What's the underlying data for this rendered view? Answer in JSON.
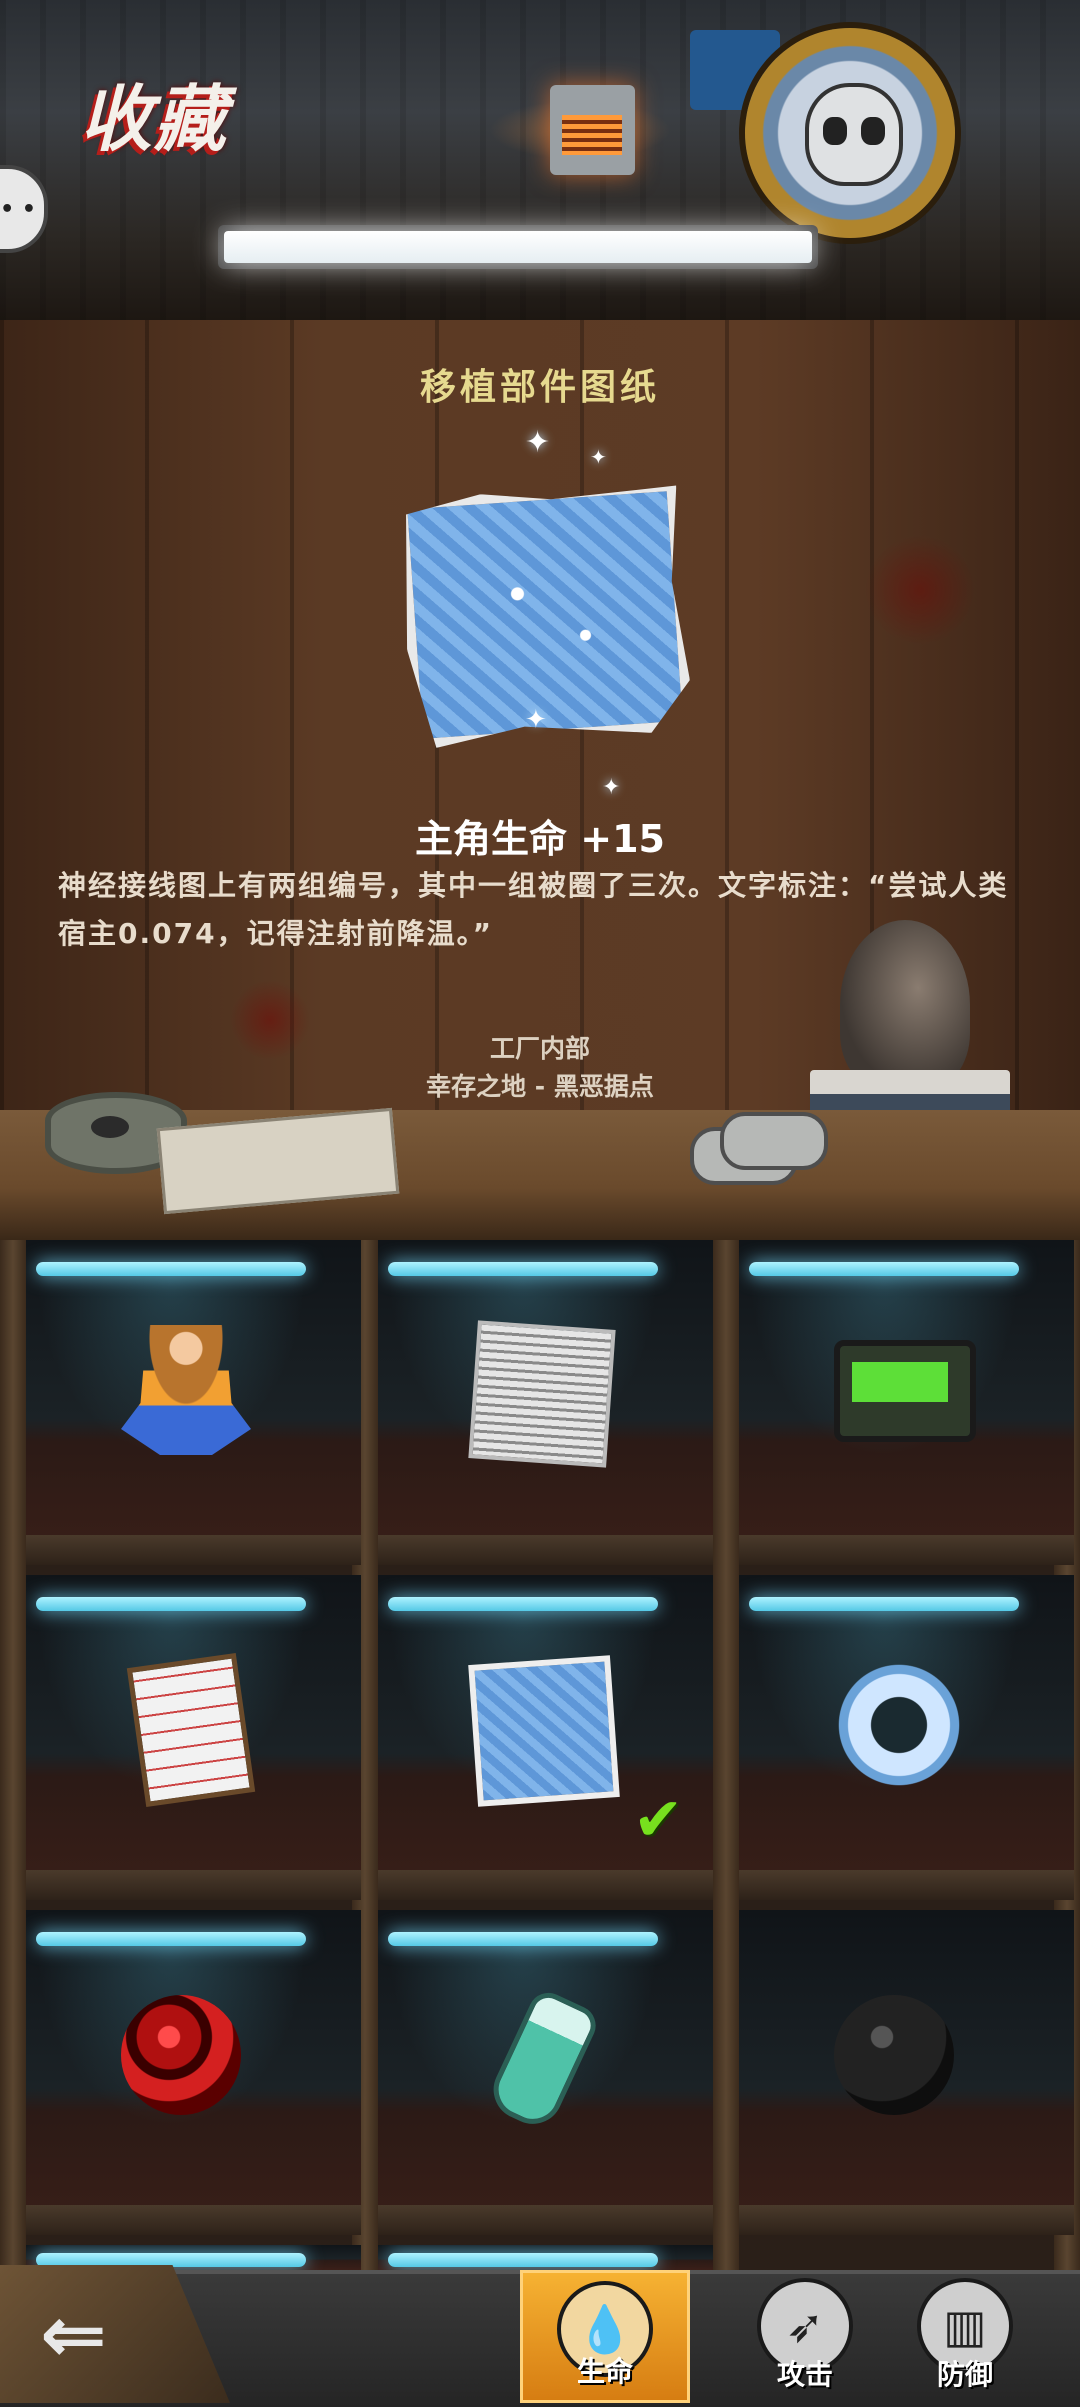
{
  "header": {
    "title": "收藏"
  },
  "detail": {
    "item_name": "移植部件图纸",
    "stat_bonus": "主角生命 +15",
    "description": "神经接线图上有两组编号，其中一组被圈了三次。文字标注：“尝试人类宿主0.074，记得注射前降温。”",
    "location_line1": "工厂内部",
    "location_line2": "幸存之地 - 黑恶据点"
  },
  "grid": {
    "items": [
      {
        "icon": "farmer-figure-icon",
        "selected": false
      },
      {
        "icon": "newspaper-icon",
        "selected": false
      },
      {
        "icon": "pager-icon",
        "selected": false
      },
      {
        "icon": "paper-scroll-icon",
        "selected": false
      },
      {
        "icon": "blueprint-icon",
        "selected": true
      },
      {
        "icon": "metal-ring-icon",
        "selected": false
      },
      {
        "icon": "red-orb-icon",
        "selected": false
      },
      {
        "icon": "bottle-icon",
        "selected": false
      },
      {
        "icon": "dark-orb-icon",
        "selected": false
      }
    ]
  },
  "tabs": [
    {
      "label": "生命",
      "icon": "droplets-icon",
      "active": true
    },
    {
      "label": "攻击",
      "icon": "rocket-icon",
      "active": false
    },
    {
      "label": "防御",
      "icon": "vest-icon",
      "active": false
    }
  ],
  "colors": {
    "accent_orange": "#f6b233",
    "item_name_yellow": "#e6d98f",
    "check_green": "#77e01e",
    "shelf_light_cyan": "#55c9e6"
  }
}
